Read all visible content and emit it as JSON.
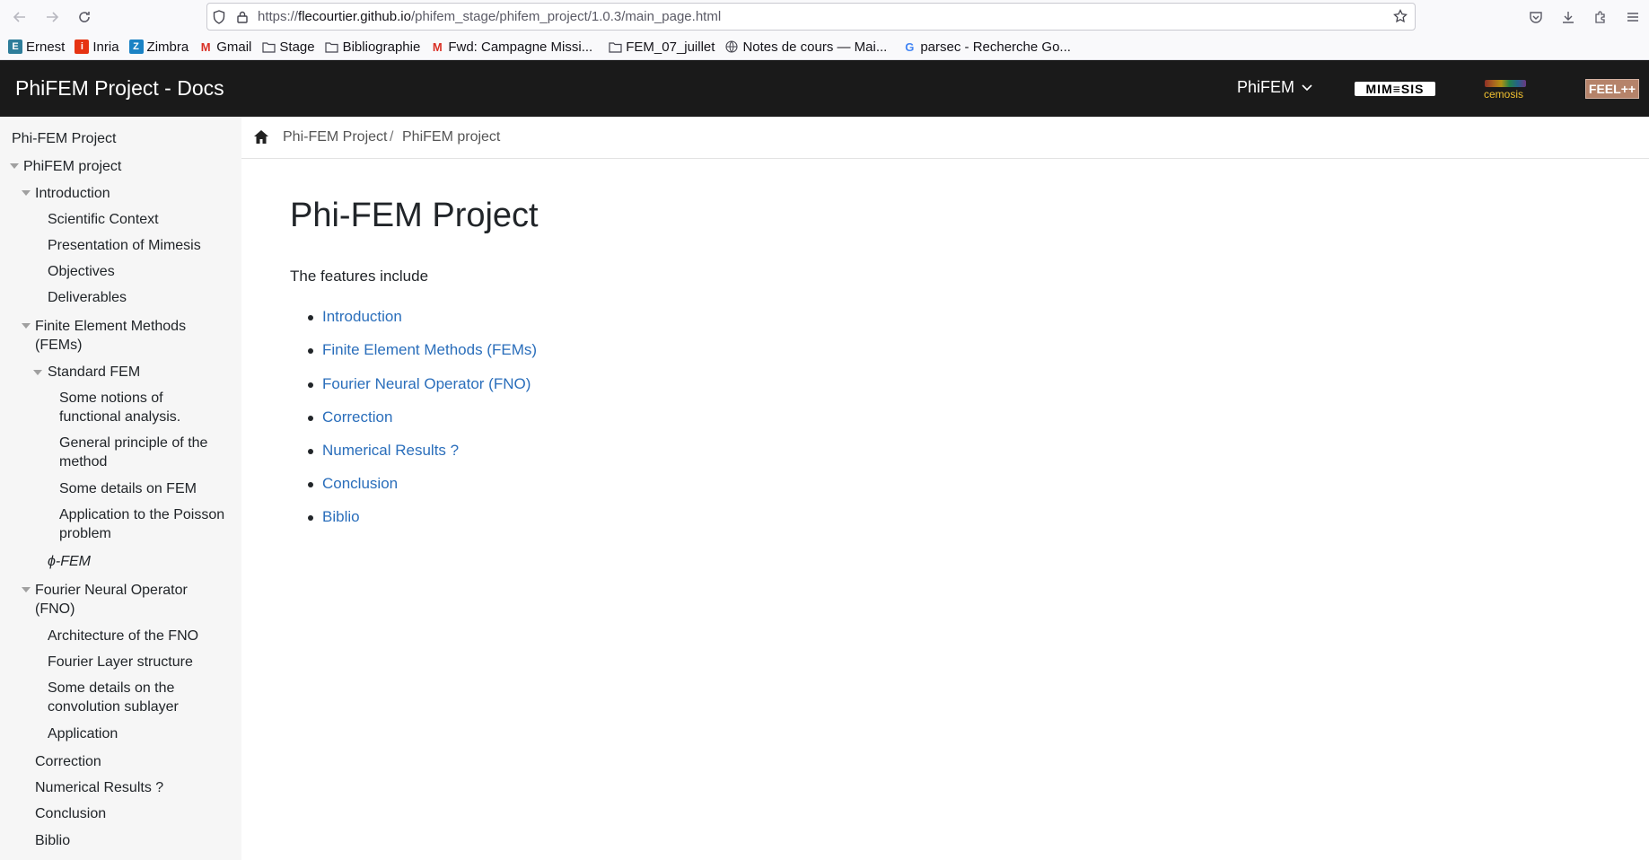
{
  "browser": {
    "url_prefix": "https://",
    "url_host": "flecourtier.github.io",
    "url_path": "/phifem_stage/phifem_project/1.0.3/main_page.html",
    "bookmarks": [
      {
        "label": "Ernest",
        "icon": "ernest-icon",
        "color": "#2e7d9a"
      },
      {
        "label": "Inria",
        "icon": "inria-icon",
        "color": "#e63312"
      },
      {
        "label": "Zimbra",
        "icon": "zimbra-icon",
        "color": "#1a82c4"
      },
      {
        "label": "Gmail",
        "icon": "gmail-icon",
        "color": "#d93025"
      },
      {
        "label": "Stage",
        "icon": "folder-icon"
      },
      {
        "label": "Bibliographie",
        "icon": "folder-icon"
      },
      {
        "label": "Fwd: Campagne Missi...",
        "icon": "gmail-icon",
        "color": "#d93025"
      },
      {
        "label": "FEM_07_juillet",
        "icon": "folder-icon"
      },
      {
        "label": "Notes de cours — Mai...",
        "icon": "globe-icon"
      },
      {
        "label": "parsec - Recherche Go...",
        "icon": "google-icon"
      }
    ]
  },
  "header": {
    "title": "PhiFEM Project - Docs",
    "version_dropdown": "PhiFEM",
    "logos": [
      "MIM≡SIS",
      "cemosis",
      "FEEL++"
    ]
  },
  "sidebar": {
    "items": [
      {
        "label": "Phi-FEM Project",
        "level": 0
      },
      {
        "label": "PhiFEM project",
        "level": 0,
        "expanded": true
      },
      {
        "label": "Introduction",
        "level": 1,
        "expanded": true
      },
      {
        "label": "Scientific Context",
        "level": 2
      },
      {
        "label": "Presentation of Mimesis",
        "level": 2
      },
      {
        "label": "Objectives",
        "level": 2
      },
      {
        "label": "Deliverables",
        "level": 2
      },
      {
        "label": "Finite Element Methods (FEMs)",
        "level": 1,
        "expanded": true
      },
      {
        "label": "Standard FEM",
        "level": 2,
        "expanded": true
      },
      {
        "label": "Some notions of functional analysis.",
        "level": 3
      },
      {
        "label": "General principle of the method",
        "level": 3
      },
      {
        "label": "Some details on FEM",
        "level": 3
      },
      {
        "label": "Application to the Poisson problem",
        "level": 3
      },
      {
        "label": "ϕ-FEM",
        "level": 2
      },
      {
        "label": "Fourier Neural Operator (FNO)",
        "level": 1,
        "expanded": true
      },
      {
        "label": "Architecture of the FNO",
        "level": 2
      },
      {
        "label": "Fourier Layer structure",
        "level": 2
      },
      {
        "label": "Some details on the convolution sublayer",
        "level": 2
      },
      {
        "label": "Application",
        "level": 2
      },
      {
        "label": "Correction",
        "level": 1
      },
      {
        "label": "Numerical Results ?",
        "level": 1
      },
      {
        "label": "Conclusion",
        "level": 1
      },
      {
        "label": "Biblio",
        "level": 1
      }
    ]
  },
  "breadcrumb": {
    "items": [
      "Phi-FEM Project",
      "PhiFEM project"
    ],
    "separator": "/"
  },
  "main": {
    "title": "Phi-FEM Project",
    "intro": "The features include",
    "links": [
      "Introduction",
      "Finite Element Methods (FEMs)",
      "Fourier Neural Operator (FNO)",
      "Correction",
      "Numerical Results ?",
      "Conclusion",
      "Biblio"
    ]
  },
  "colors": {
    "header_bg": "#1a1a1a",
    "sidebar_bg": "#f6f6f6",
    "link": "#2a6ebb"
  }
}
